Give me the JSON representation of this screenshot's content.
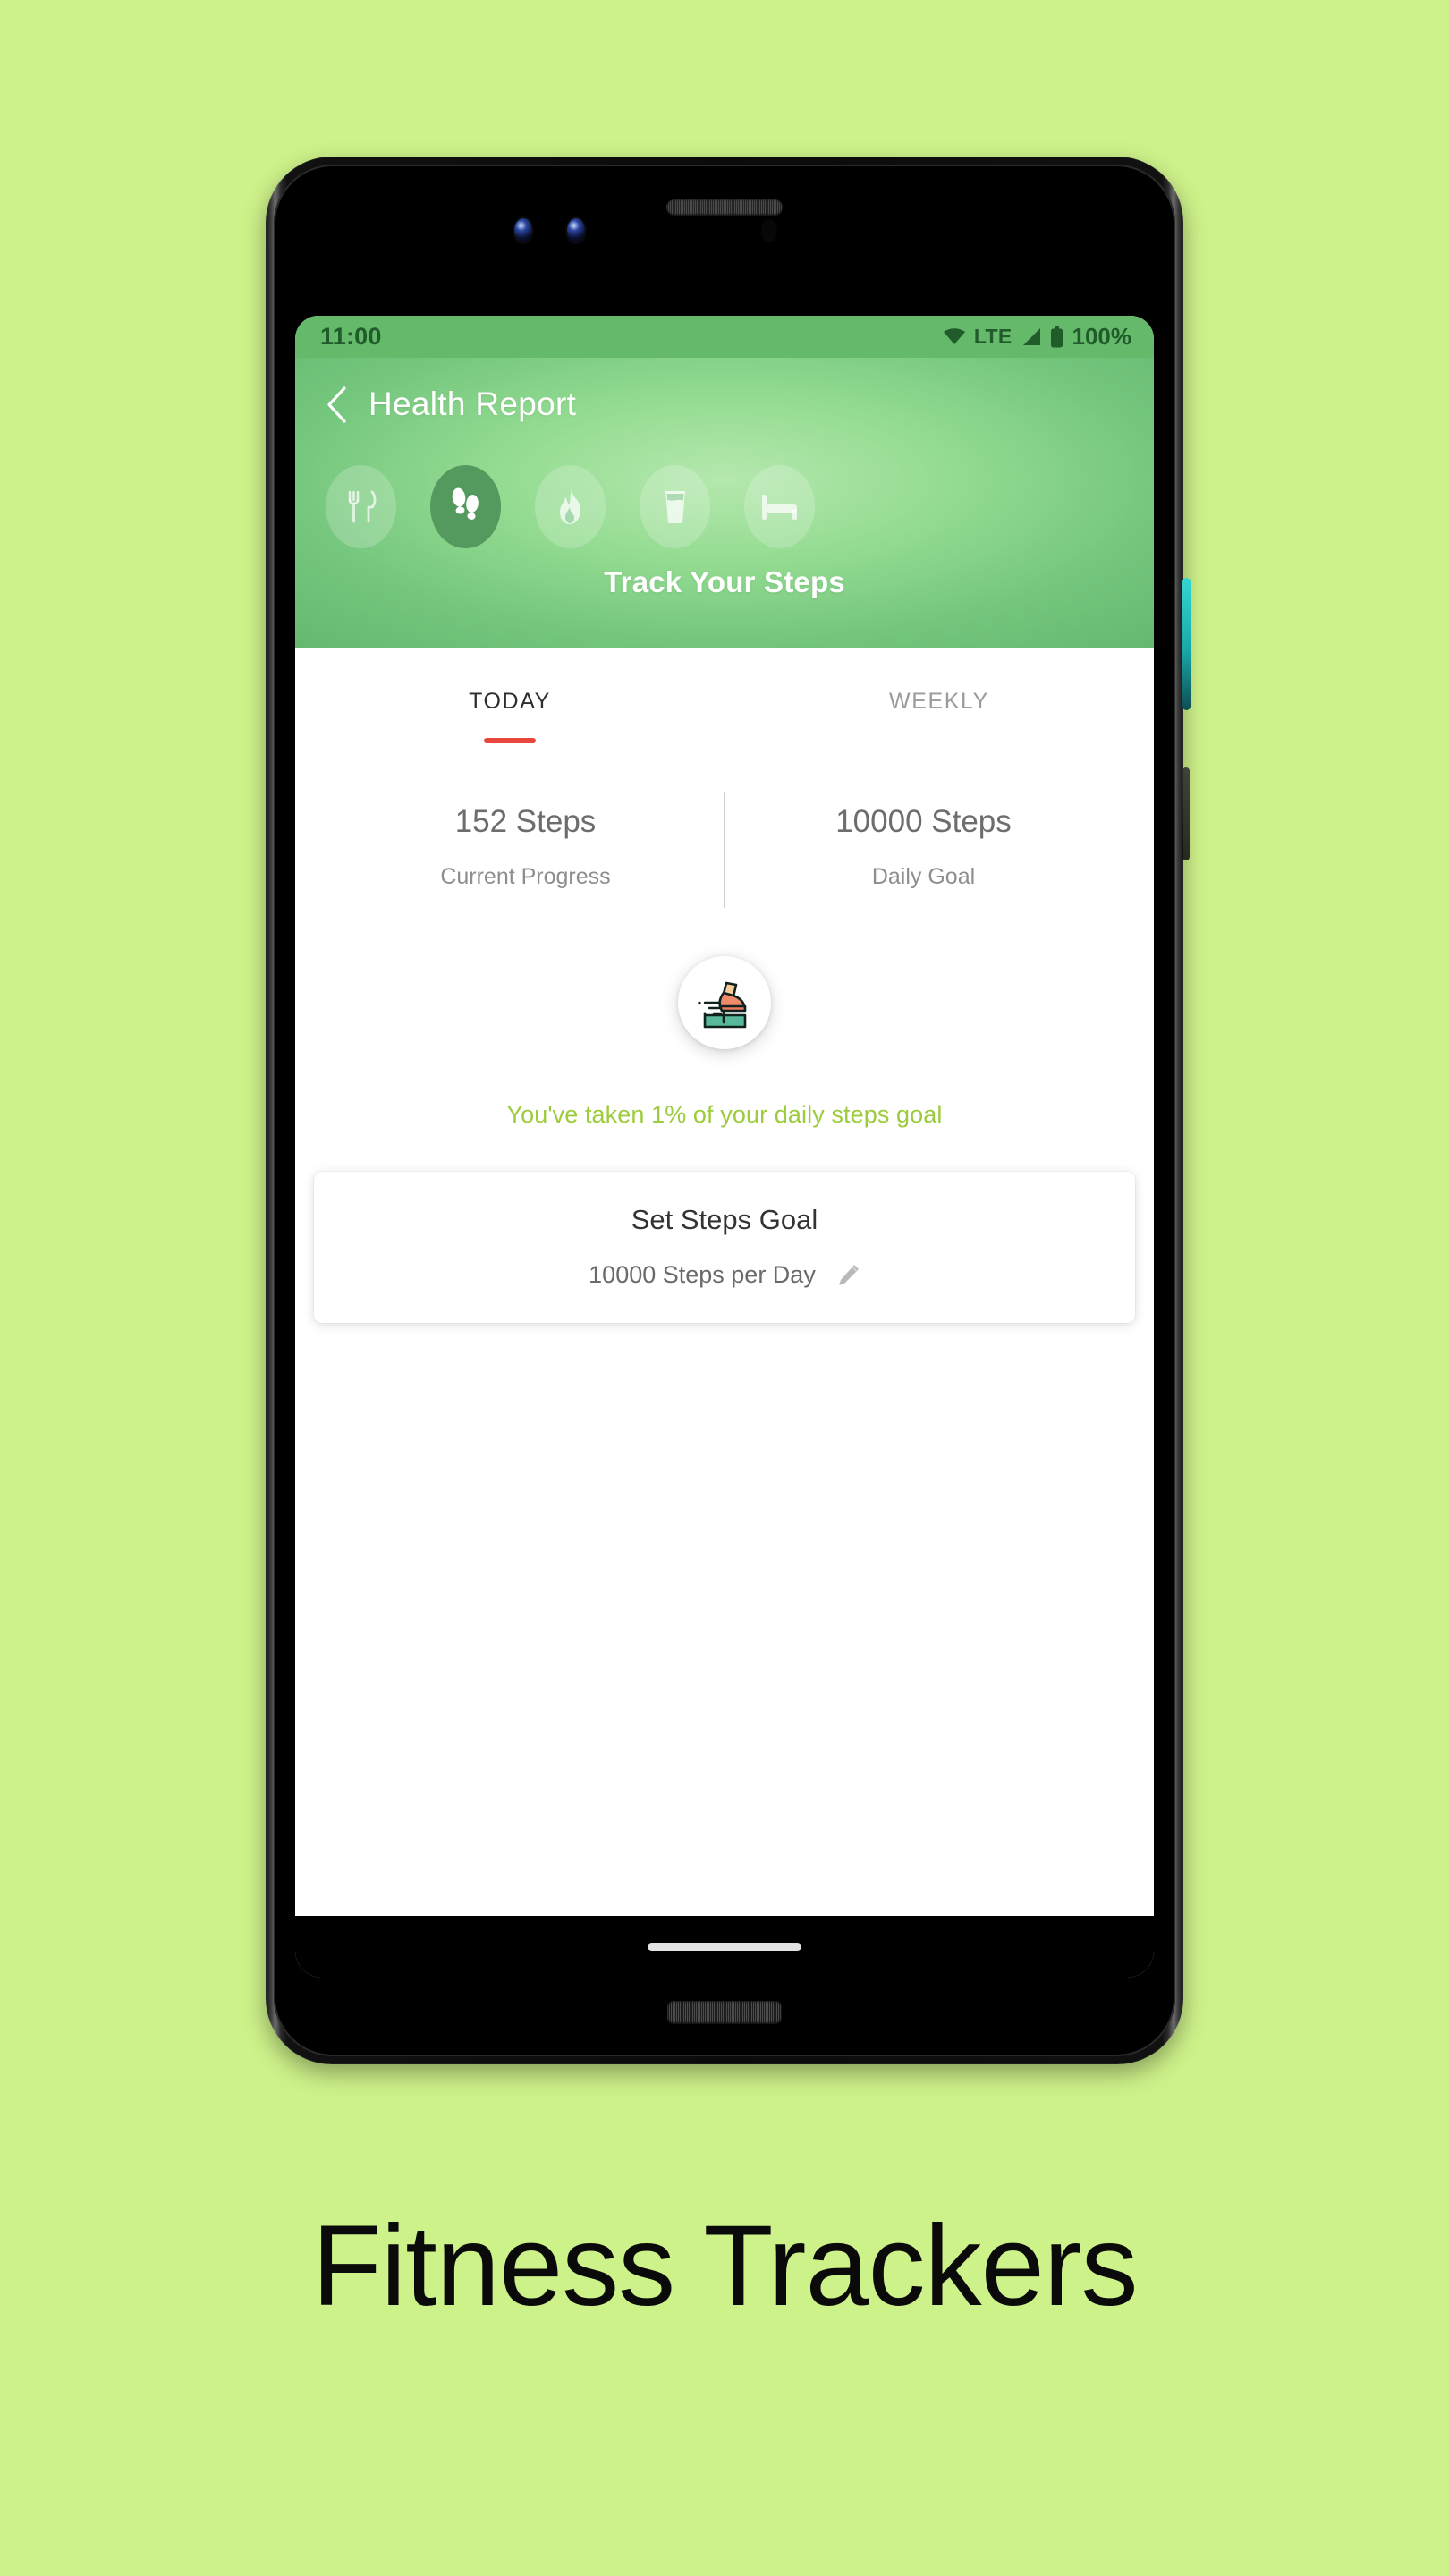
{
  "page": {
    "background_color": "#cef28a",
    "caption": "Fitness Trackers"
  },
  "device": {
    "name": "android-phone-mockup",
    "frame_color": "#0b0b0b",
    "power_button_color": "#25bdbb"
  },
  "status_bar": {
    "time": "11:00",
    "network_label": "LTE",
    "battery_percent": "100%",
    "icons": [
      "wifi-icon",
      "signal-icon",
      "battery-icon"
    ],
    "background_color": "#64b96a",
    "foreground_color": "#1f5c2a"
  },
  "header": {
    "title": "Health Report",
    "back_icon": "back-chevron-icon",
    "subtitle": "Track Your Steps",
    "gradient_center": "#b5e8ae",
    "gradient_edge": "#66b970",
    "active_chip_color": "#549a5e",
    "categories": [
      {
        "id": "food",
        "icon": "fork-knife-icon",
        "active": false
      },
      {
        "id": "steps",
        "icon": "footprints-icon",
        "active": true
      },
      {
        "id": "calories",
        "icon": "flame-icon",
        "active": false
      },
      {
        "id": "water",
        "icon": "water-glass-icon",
        "active": false
      },
      {
        "id": "sleep",
        "icon": "bed-icon",
        "active": false
      }
    ]
  },
  "tabs": [
    {
      "label": "TODAY",
      "selected": true
    },
    {
      "label": "WEEKLY",
      "selected": false
    }
  ],
  "tab_accent_color": "#e8453c",
  "stats": [
    {
      "value": "152 Steps",
      "caption": "Current Progress"
    },
    {
      "value": "10000 Steps",
      "caption": "Daily Goal"
    }
  ],
  "badge": {
    "icon": "stepping-shoe-icon",
    "shoe_color": "#ef8a6b",
    "step_color": "#57b89b",
    "sock_color": "#f9cd9a"
  },
  "progress_message": {
    "text": "You've taken 1% of your daily steps goal",
    "color": "#9ccc3c",
    "percent": 1
  },
  "goal_card": {
    "title": "Set Steps Goal",
    "value": "10000 Steps per Day",
    "edit_icon": "edit-pencil-icon"
  },
  "gesture_nav": {
    "handle": "home-gesture-handle"
  }
}
